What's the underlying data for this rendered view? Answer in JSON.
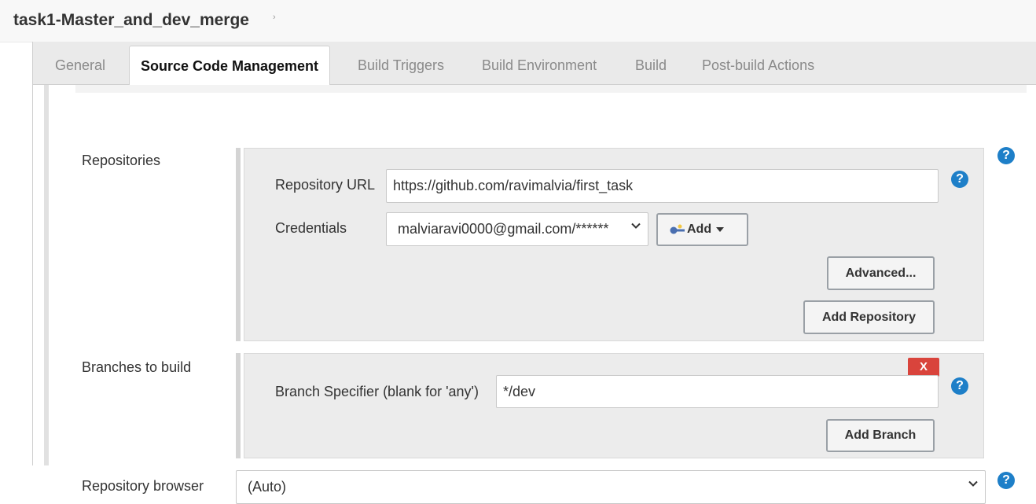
{
  "header": {
    "job_title": "task1-Master_and_dev_merge",
    "arrow": "›"
  },
  "tabs": [
    {
      "label": "General"
    },
    {
      "label": "Source Code Management"
    },
    {
      "label": "Build Triggers"
    },
    {
      "label": "Build Environment"
    },
    {
      "label": "Build"
    },
    {
      "label": "Post-build Actions"
    }
  ],
  "active_tab": "Source Code Management",
  "repositories": {
    "label": "Repositories",
    "url_label": "Repository URL",
    "url_value": "https://github.com/ravimalvia/first_task",
    "credentials_label": "Credentials",
    "credentials_value": "malviaravi0000@gmail.com/******",
    "add_label": "Add",
    "advanced_label": "Advanced...",
    "add_repository_label": "Add Repository"
  },
  "branches": {
    "label": "Branches to build",
    "delete_label": "X",
    "specifier_label": "Branch Specifier (blank for 'any')",
    "specifier_value": "*/dev",
    "add_branch_label": "Add Branch"
  },
  "repo_browser": {
    "label": "Repository browser",
    "value": "(Auto)"
  },
  "help_glyph": "?",
  "colors": {
    "help": "#1e7fc8",
    "delete": "#d9443c",
    "tab_bar": "#eaeaea"
  }
}
